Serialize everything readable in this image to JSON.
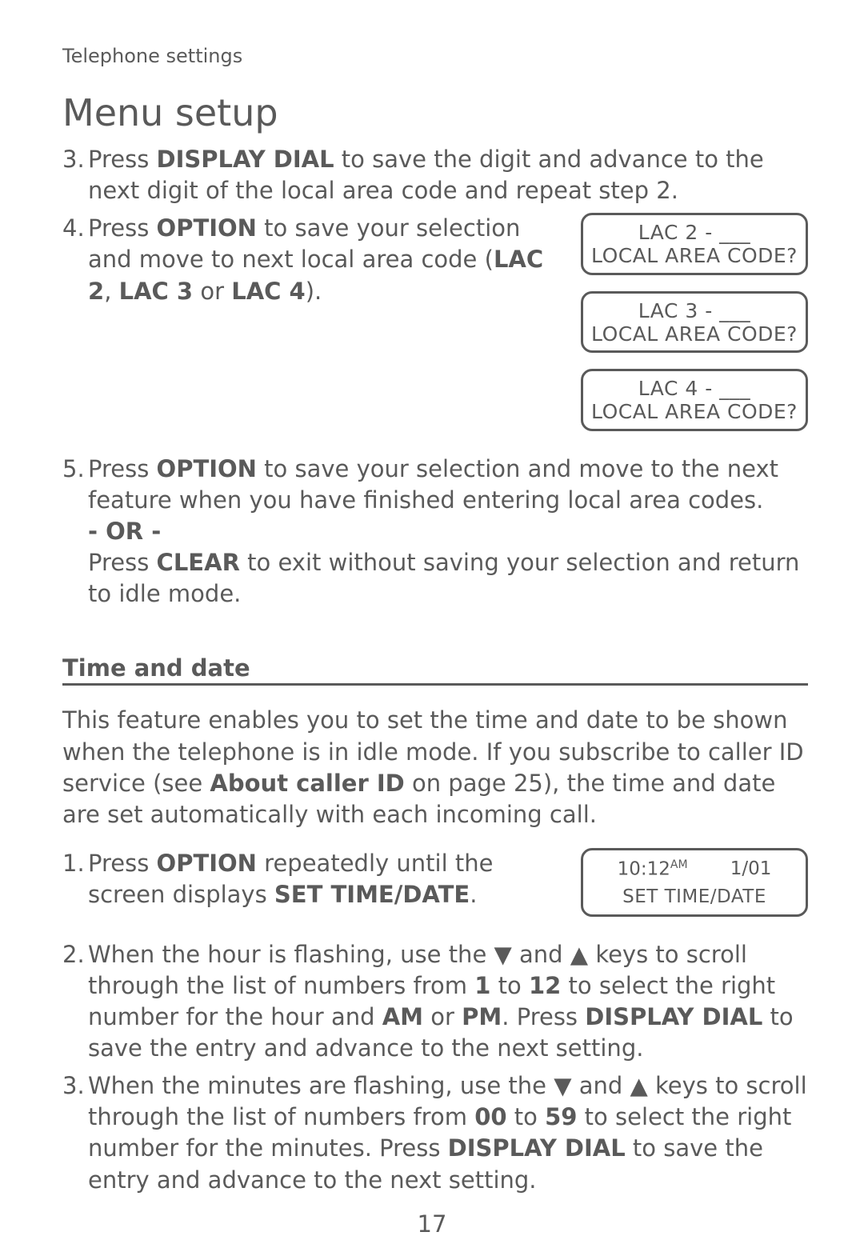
{
  "breadcrumb": "Telephone settings",
  "title": "Menu setup",
  "steps_a": [
    {
      "n": "3.",
      "pre": "Press ",
      "b1": "DISPLAY DIAL",
      "post": " to save the digit and advance to the next digit of the local area code and repeat step 2."
    },
    {
      "n": "4.",
      "pre": "Press ",
      "b1": "OPTION",
      "mid1": " to save your selection and move to next local area code (",
      "b2": "LAC 2",
      "mid2": ", ",
      "b3": "LAC 3",
      "mid3": " or ",
      "b4": "LAC 4",
      "post": ")."
    },
    {
      "n": "5.",
      "pre": "Press ",
      "b1": "OPTION",
      "mid1": " to save your selection and move to the next feature when you have finished entering local area codes.",
      "or": "- OR -",
      "pre2": "Press ",
      "b5": "CLEAR",
      "post2": " to exit without saving your selection and return to idle mode."
    }
  ],
  "lcd_boxes": [
    {
      "l1": "LAC 2 - ___",
      "l2": "LOCAL AREA CODE?"
    },
    {
      "l1": "LAC 3 - ___",
      "l2": "LOCAL AREA CODE?"
    },
    {
      "l1": "LAC 4 - ___",
      "l2": "LOCAL AREA CODE?"
    }
  ],
  "section2": {
    "heading": "Time and date",
    "intro_pre": "This feature enables you to set the time and date to be shown when the telephone is in idle mode. If you subscribe to caller ID service (see ",
    "intro_b": "About caller ID",
    "intro_post": " on page 25), the time and date are set automatically with each incoming call.",
    "lcd_time": {
      "time": "10:12",
      "ampm": "AM",
      "date": "1/01",
      "label": "SET TIME/DATE"
    },
    "steps": [
      {
        "n": "1.",
        "pre": "Press ",
        "b1": "OPTION",
        "mid1": " repeatedly until the screen displays ",
        "b2": "SET TIME/DATE",
        "post": "."
      },
      {
        "n": "2.",
        "pre": "When the hour is flashing, use the ▼ and ▲ keys to scroll through the list of numbers from ",
        "b1": "1",
        "mid1": " to ",
        "b2": "12",
        "mid2": " to select the right number for the hour and ",
        "b3": "AM",
        "mid3": " or ",
        "b4": "PM",
        "mid4": ". Press ",
        "b5": "DISPLAY DIAL",
        "post": " to save the entry and advance to the next setting."
      },
      {
        "n": "3.",
        "pre": "When the minutes are flashing, use the ▼ and ▲ keys to scroll through the list of numbers from ",
        "b1": "00",
        "mid1": " to ",
        "b2": "59",
        "mid2": " to select the right number for the minutes. Press ",
        "b3": "DISPLAY DIAL",
        "post": " to save the entry and advance to the next setting."
      }
    ]
  },
  "page_number": "17"
}
